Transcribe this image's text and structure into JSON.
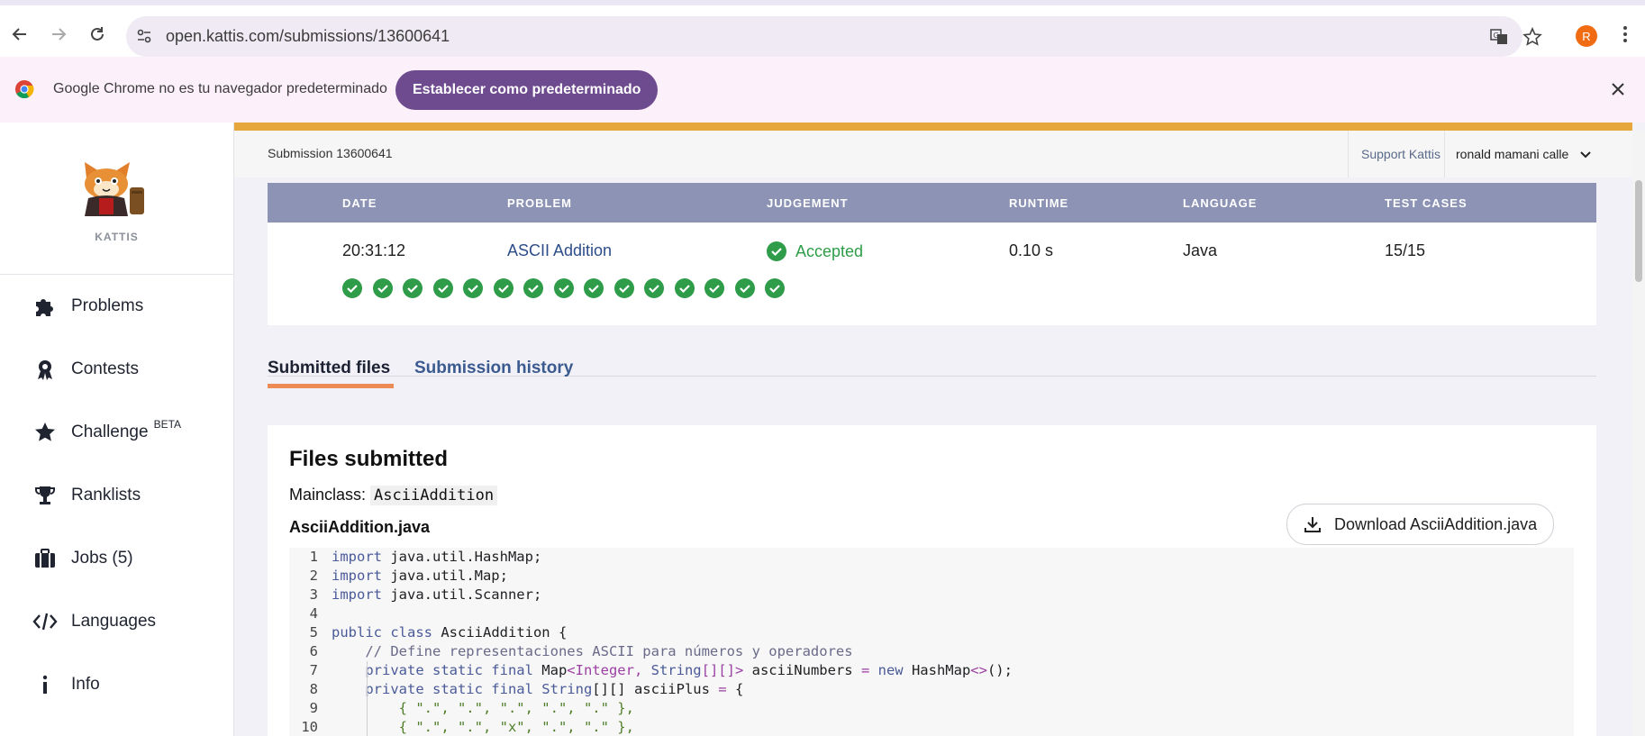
{
  "browser": {
    "url": "open.kattis.com/submissions/13600641",
    "avatar_letter": "R",
    "infobar_message": "Google Chrome no es tu navegador predeterminado",
    "infobar_button": "Establecer como predeterminado"
  },
  "sidebar": {
    "logo_label": "KATTIS",
    "items": [
      {
        "label": "Problems",
        "icon": "puzzle-icon"
      },
      {
        "label": "Contests",
        "icon": "ribbon-icon"
      },
      {
        "label": "Challenge",
        "icon": "star-icon",
        "badge": "BETA"
      },
      {
        "label": "Ranklists",
        "icon": "trophy-icon"
      },
      {
        "label": "Jobs (5)",
        "icon": "briefcase-icon"
      },
      {
        "label": "Languages",
        "icon": "code-icon"
      },
      {
        "label": "Info",
        "icon": "info-icon"
      }
    ]
  },
  "header": {
    "title": "Submission 13600641",
    "support": "Support Kattis",
    "user": "ronald mamani calle"
  },
  "submission_table": {
    "headers": [
      "DATE",
      "PROBLEM",
      "JUDGEMENT",
      "RUNTIME",
      "LANGUAGE",
      "TEST CASES"
    ],
    "row": {
      "date": "20:31:12",
      "problem": "ASCII Addition",
      "judgement": "Accepted",
      "runtime": "0.10 s",
      "language": "Java",
      "test_cases": "15/15"
    },
    "passed_tests": 15
  },
  "tabs": {
    "submitted_files": "Submitted files",
    "submission_history": "Submission history"
  },
  "files": {
    "title": "Files submitted",
    "mainclass_label": "Mainclass:",
    "mainclass_value": "AsciiAddition",
    "filename": "AsciiAddition.java",
    "download_label": "Download AsciiAddition.java",
    "code_line_numbers": [
      "1",
      "2",
      "3",
      "4",
      "5",
      "6",
      "7",
      "8",
      "9",
      "10"
    ],
    "code_text": {
      "l1": "java.util.HashMap;",
      "l2": "java.util.Map;",
      "l3": "java.util.Scanner;",
      "l5": "AsciiAddition {",
      "l6": "// Define representaciones ASCII para números y operadores",
      "l7_a": "Map",
      "l7_b": "<Integer, ",
      "l7_c": "String",
      "l7_d": "[][]>",
      "l7_e": " asciiNumbers ",
      "l7_f": "=",
      "l7_g": " new ",
      "l7_h": "HashMap",
      "l7_i": "<>",
      "l7_j": "();",
      "l8_a": "String",
      "l8_b": "[][] asciiPlus ",
      "l8_c": "=",
      "l8_d": " {",
      "l9": "{ \".\", \".\", \".\", \".\", \".\" },",
      "l10": "{ \".\", \".\", \"x\", \".\", \".\" },"
    }
  },
  "colors": {
    "accent_orange": "#e6a73c",
    "accepted_green": "#2e9c48",
    "table_header": "#8c93b5",
    "link_blue": "#2c4d8a",
    "infobar_button": "#6e4a8e"
  }
}
